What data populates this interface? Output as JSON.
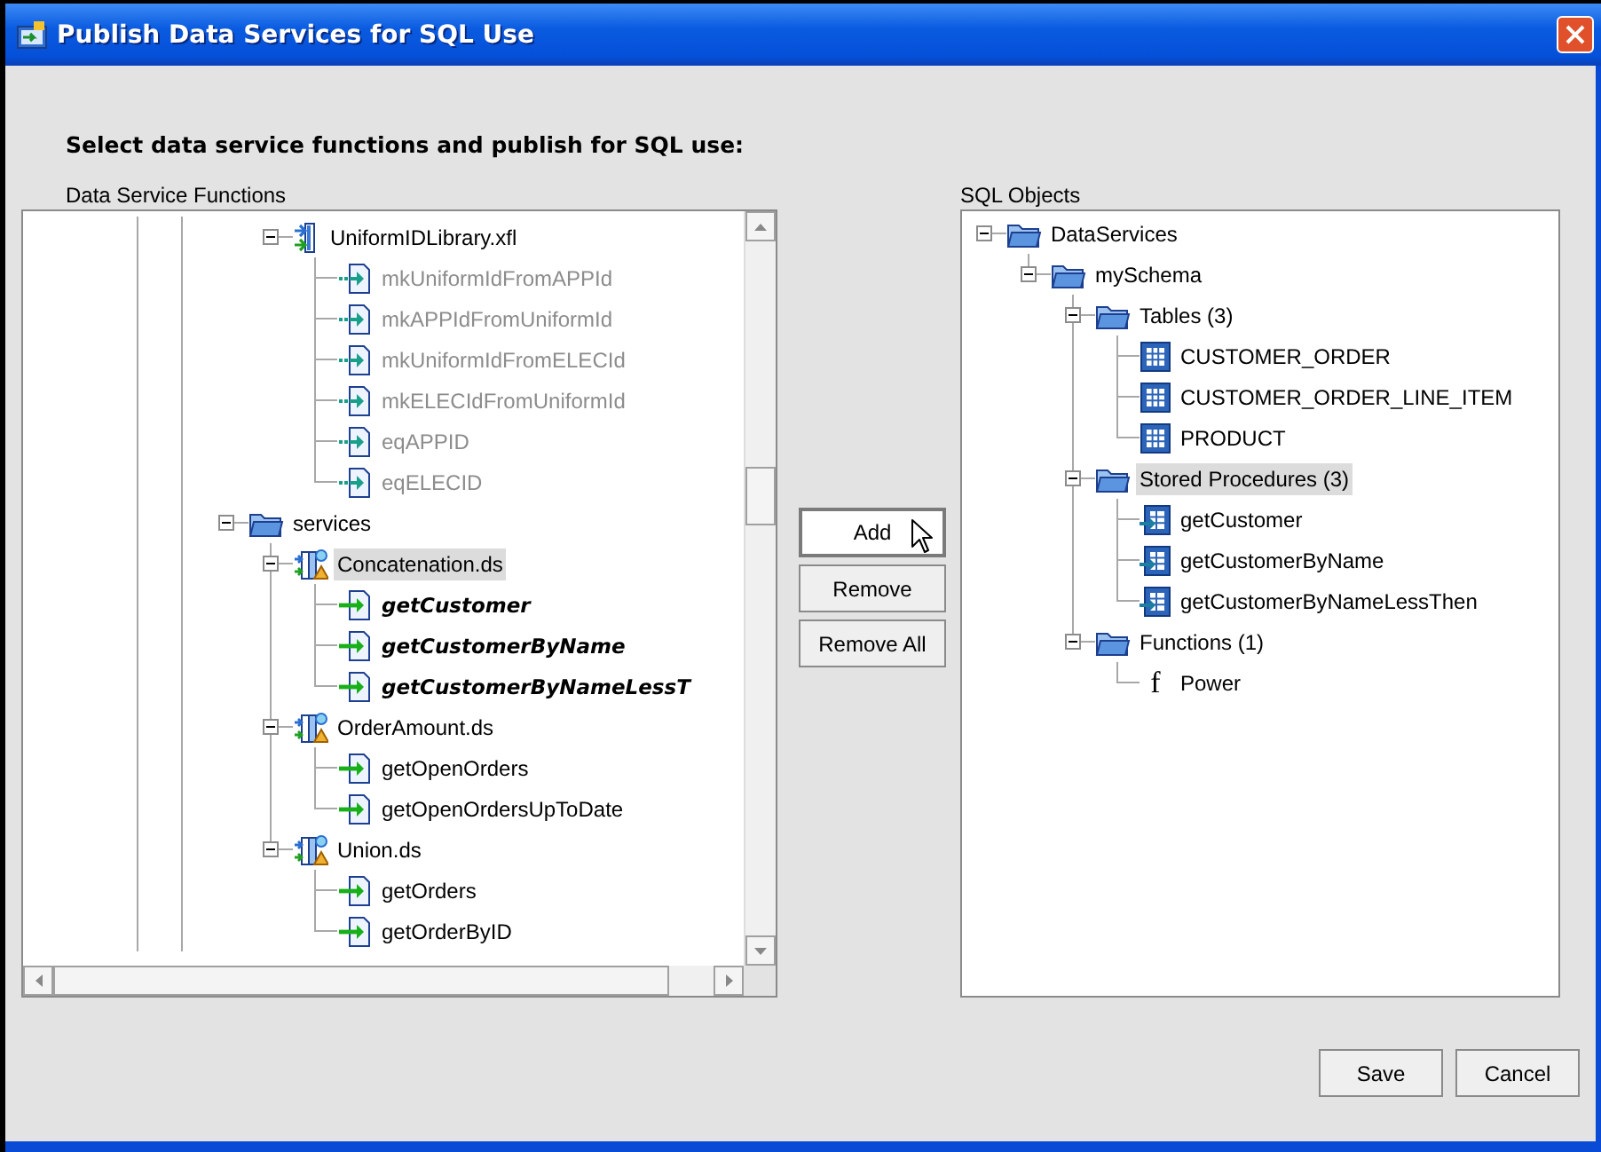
{
  "window": {
    "title": "Publish Data Services for SQL Use"
  },
  "heading": "Select data service functions and publish for SQL use:",
  "function_tree": {
    "label": "Data Service Functions",
    "nodes": [
      {
        "kind": "library",
        "label": "UniformIDLibrary.xfl",
        "expanded": true,
        "selected": false,
        "children": [
          {
            "kind": "function",
            "label": "mkUniformIdFromAPPId",
            "disabled": true,
            "published": false,
            "selected": false
          },
          {
            "kind": "function",
            "label": "mkAPPIdFromUniformId",
            "disabled": true,
            "published": false,
            "selected": false
          },
          {
            "kind": "function",
            "label": "mkUniformIdFromELECId",
            "disabled": true,
            "published": false,
            "selected": false
          },
          {
            "kind": "function",
            "label": "mkELECIdFromUniformId",
            "disabled": true,
            "published": false,
            "selected": false
          },
          {
            "kind": "function",
            "label": "eqAPPID",
            "disabled": true,
            "published": false,
            "selected": false
          },
          {
            "kind": "function",
            "label": "eqELECID",
            "disabled": true,
            "published": false,
            "selected": false
          }
        ]
      },
      {
        "kind": "folder",
        "label": "services",
        "expanded": true,
        "selected": false,
        "children": [
          {
            "kind": "data-service",
            "label": "Concatenation.ds",
            "expanded": true,
            "selected": true,
            "children": [
              {
                "kind": "function",
                "label": "getCustomer",
                "disabled": false,
                "published": true,
                "selected": false
              },
              {
                "kind": "function",
                "label": "getCustomerByName",
                "disabled": false,
                "published": true,
                "selected": false
              },
              {
                "kind": "function",
                "label": "getCustomerByNameLessT",
                "disabled": false,
                "published": true,
                "selected": false
              }
            ]
          },
          {
            "kind": "data-service",
            "label": "OrderAmount.ds",
            "expanded": true,
            "selected": false,
            "children": [
              {
                "kind": "function",
                "label": "getOpenOrders",
                "disabled": false,
                "published": false,
                "selected": false
              },
              {
                "kind": "function",
                "label": "getOpenOrdersUpToDate",
                "disabled": false,
                "published": false,
                "selected": false
              }
            ]
          },
          {
            "kind": "data-service",
            "label": "Union.ds",
            "expanded": true,
            "selected": false,
            "children": [
              {
                "kind": "function",
                "label": "getOrders",
                "disabled": false,
                "published": false,
                "selected": false
              },
              {
                "kind": "function",
                "label": "getOrderByID",
                "disabled": false,
                "published": false,
                "selected": false
              }
            ]
          }
        ]
      }
    ]
  },
  "buttons": [
    {
      "label": "Add",
      "kind": "default"
    },
    {
      "label": "Remove",
      "kind": "normal"
    },
    {
      "label": "Remove All",
      "kind": "normal"
    }
  ],
  "sql_tree": {
    "label": "SQL Objects",
    "nodes": [
      {
        "kind": "folder",
        "label": "DataServices",
        "expanded": true,
        "selected": false,
        "children": [
          {
            "kind": "folder",
            "label": "mySchema",
            "expanded": true,
            "selected": false,
            "children": [
              {
                "kind": "folder",
                "label": "Tables (3)",
                "expanded": true,
                "selected": false,
                "children": [
                  {
                    "kind": "table",
                    "label": "CUSTOMER_ORDER",
                    "selected": false
                  },
                  {
                    "kind": "table",
                    "label": "CUSTOMER_ORDER_LINE_ITEM",
                    "selected": false
                  },
                  {
                    "kind": "table",
                    "label": "PRODUCT",
                    "selected": false
                  }
                ]
              },
              {
                "kind": "folder",
                "label": "Stored Procedures (3)",
                "expanded": true,
                "selected": true,
                "children": [
                  {
                    "kind": "procedure",
                    "label": "getCustomer",
                    "selected": false
                  },
                  {
                    "kind": "procedure",
                    "label": "getCustomerByName",
                    "selected": false
                  },
                  {
                    "kind": "procedure",
                    "label": "getCustomerByNameLessThen",
                    "selected": false
                  }
                ]
              },
              {
                "kind": "folder",
                "label": "Functions (1)",
                "expanded": true,
                "selected": false,
                "children": [
                  {
                    "kind": "sql-function",
                    "label": "Power",
                    "icon": "f",
                    "selected": false
                  }
                ]
              }
            ]
          }
        ]
      }
    ]
  },
  "footer_buttons": [
    "Save",
    "Cancel"
  ]
}
